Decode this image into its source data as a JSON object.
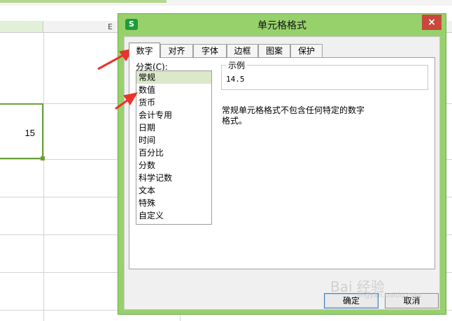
{
  "spreadsheet": {
    "column_letter": "E",
    "cell_value": "15"
  },
  "dialog": {
    "app_icon_letter": "S",
    "title": "单元格格式",
    "close_symbol": "×",
    "tabs": [
      {
        "label": "数字"
      },
      {
        "label": "对齐"
      },
      {
        "label": "字体"
      },
      {
        "label": "边框"
      },
      {
        "label": "图案"
      },
      {
        "label": "保护"
      }
    ],
    "active_tab": "数字",
    "category_label": "分类(C):",
    "categories": [
      {
        "label": "常规"
      },
      {
        "label": "数值"
      },
      {
        "label": "货币"
      },
      {
        "label": "会计专用"
      },
      {
        "label": "日期"
      },
      {
        "label": "时间"
      },
      {
        "label": "百分比"
      },
      {
        "label": "分数"
      },
      {
        "label": "科学记数"
      },
      {
        "label": "文本"
      },
      {
        "label": "特殊"
      },
      {
        "label": "自定义"
      }
    ],
    "selected_category": "常规",
    "sample": {
      "label": "示例",
      "value": "14.5"
    },
    "description_line1": "常规单元格格式不包含任何特定的数字",
    "description_line2": "格式。",
    "buttons": {
      "ok": "确定",
      "cancel": "取消"
    }
  },
  "annotations": {
    "arrow_color": "#e8352b"
  },
  "watermark": {
    "text": "Bai 经验",
    "sub": "jingyan.baidu.com"
  },
  "colors": {
    "dialog_frame": "#97d16b",
    "selection_green": "#6aa23a",
    "close_red": "#c9483b"
  }
}
